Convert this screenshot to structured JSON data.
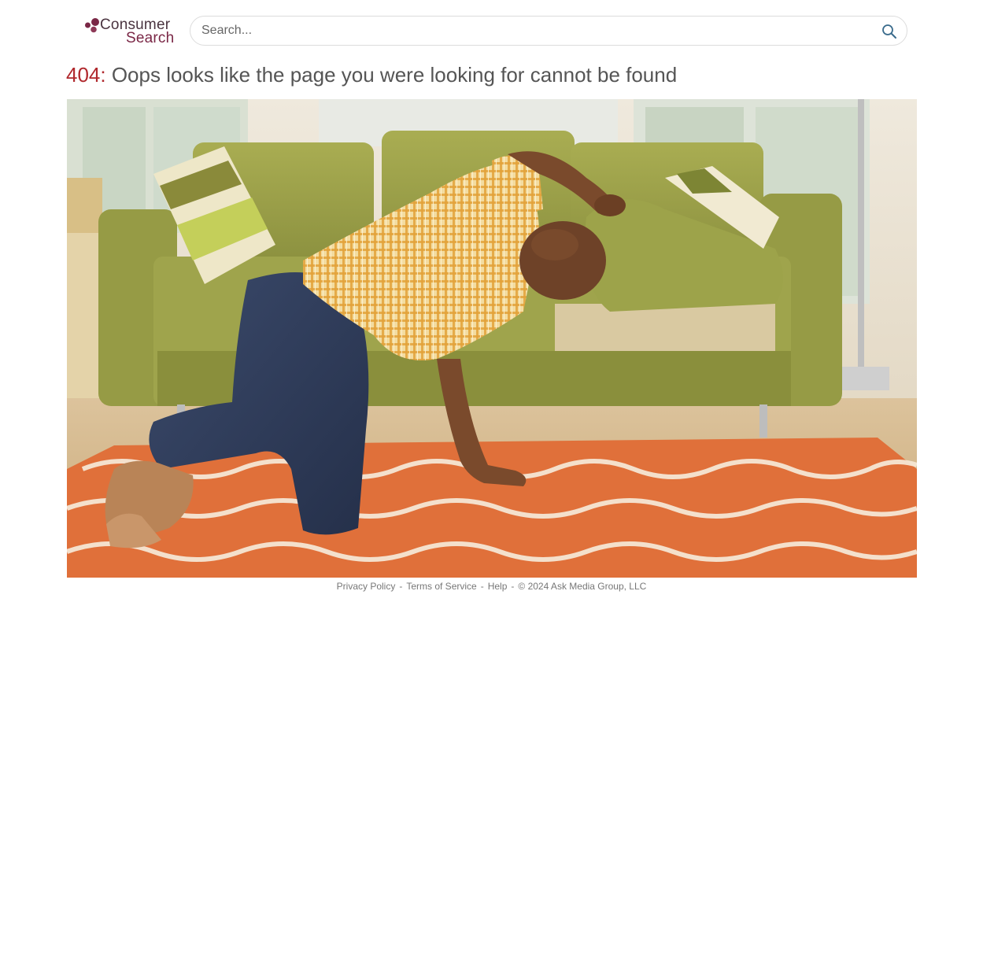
{
  "header": {
    "logo": {
      "line1": "Consumer",
      "line2": "Search",
      "dot_color": "#7a2746"
    },
    "search": {
      "placeholder": "Search...",
      "value": "",
      "icon": "search-icon",
      "icon_color": "#3a6b8c"
    }
  },
  "main": {
    "error_code": "404:",
    "error_message": " Oops looks like the page you were looking for cannot be found",
    "error_code_color": "#b0282d",
    "hero_image": "man-searching-under-couch-cushion-photo"
  },
  "footer": {
    "links": [
      {
        "label": "Privacy Policy"
      },
      {
        "label": "Terms of Service"
      },
      {
        "label": "Help"
      }
    ],
    "separator": "-",
    "copyright": "© 2024 Ask Media Group, LLC"
  }
}
